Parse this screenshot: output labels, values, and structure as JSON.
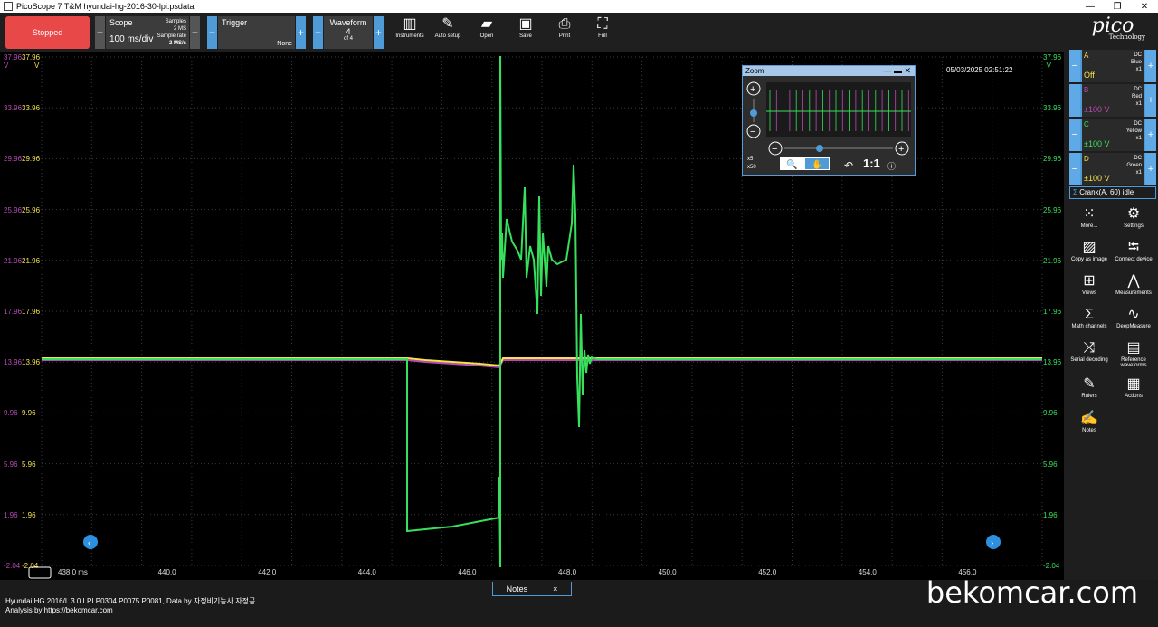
{
  "titlebar": {
    "title": "PicoScope 7 T&M hyundai-hg-2016-30-lpi.psdata",
    "min": "—",
    "max": "❐",
    "close": "✕"
  },
  "toolbar": {
    "stopped_label": "Stopped",
    "scope": {
      "label": "Scope",
      "value": "100 ms/div",
      "samples_label": "Samples",
      "samples": "2 MS",
      "rate_label": "Sample rate",
      "rate": "2 MS/s"
    },
    "trigger": {
      "label": "Trigger",
      "mode": "None"
    },
    "waveform": {
      "label": "Waveform",
      "index": "4",
      "of": "of 4"
    },
    "tools": [
      "Instruments",
      "Auto setup",
      "Open",
      "Save",
      "Print",
      "Full"
    ]
  },
  "logo": {
    "text": "pico",
    "sub": "Technology"
  },
  "plot": {
    "timestamp": "05/03/2025 02:51:22",
    "y_ticks_left_purple": [
      "37.96",
      "33.96",
      "29.96",
      "25.96",
      "21.96",
      "17.96",
      "13.96",
      "9.96",
      "5.96",
      "1.96",
      "-2.04"
    ],
    "y_ticks_left_yellow": [
      "37.96",
      "33.96",
      "29.96",
      "25.96",
      "21.96",
      "17.96",
      "13.96",
      "9.96",
      "5.96",
      "1.96",
      "-2.04"
    ],
    "y_ticks_right": [
      "37.96",
      "33.96",
      "29.96",
      "25.96",
      "21.96",
      "17.96",
      "13.96",
      "9.96",
      "5.96",
      "1.96",
      "-2.04"
    ],
    "unit_v": "V",
    "x_ticks": [
      "438.0 ms",
      "440.0",
      "442.0",
      "444.0",
      "446.0",
      "448.0",
      "450.0",
      "452.0",
      "454.0",
      "456.0"
    ]
  },
  "zoom": {
    "title": "Zoom",
    "x5": "x5",
    "x50": "x50",
    "ratio": "1:1"
  },
  "channels": [
    {
      "letter": "A",
      "range": "Off",
      "coupling": "DC",
      "color_name": "Blue",
      "probe": "x1",
      "color": "#f6e24a"
    },
    {
      "letter": "B",
      "range": "±100 V",
      "coupling": "DC",
      "color_name": "Red",
      "probe": "x1",
      "color": "#b84bb5"
    },
    {
      "letter": "C",
      "range": "±100 V",
      "coupling": "DC",
      "color_name": "Yellow",
      "probe": "x1",
      "color": "#37e05c"
    },
    {
      "letter": "D",
      "range": "±100 V",
      "coupling": "DC",
      "color_name": "Green",
      "probe": "x1",
      "color": "#f6e24a"
    }
  ],
  "math_channel": "Crank(A, 60) idle",
  "side_buttons": [
    "More...",
    "Settings",
    "Copy as image",
    "Connect device",
    "Views",
    "Measurements",
    "Math channels",
    "DeepMeasure",
    "Serial decoding",
    "Reference waveforms",
    "Rulers",
    "Actions",
    "Notes"
  ],
  "status": {
    "line1": "Hyundai HG 2016/L 3.0 LPI P0304 P0075 P0081, Data by 자정비기능사 자정공",
    "line2": "Analysis by https://bekomcar.com",
    "notes_tab": "Notes",
    "notes_close": "×"
  },
  "watermark": "bekomcar.com"
}
